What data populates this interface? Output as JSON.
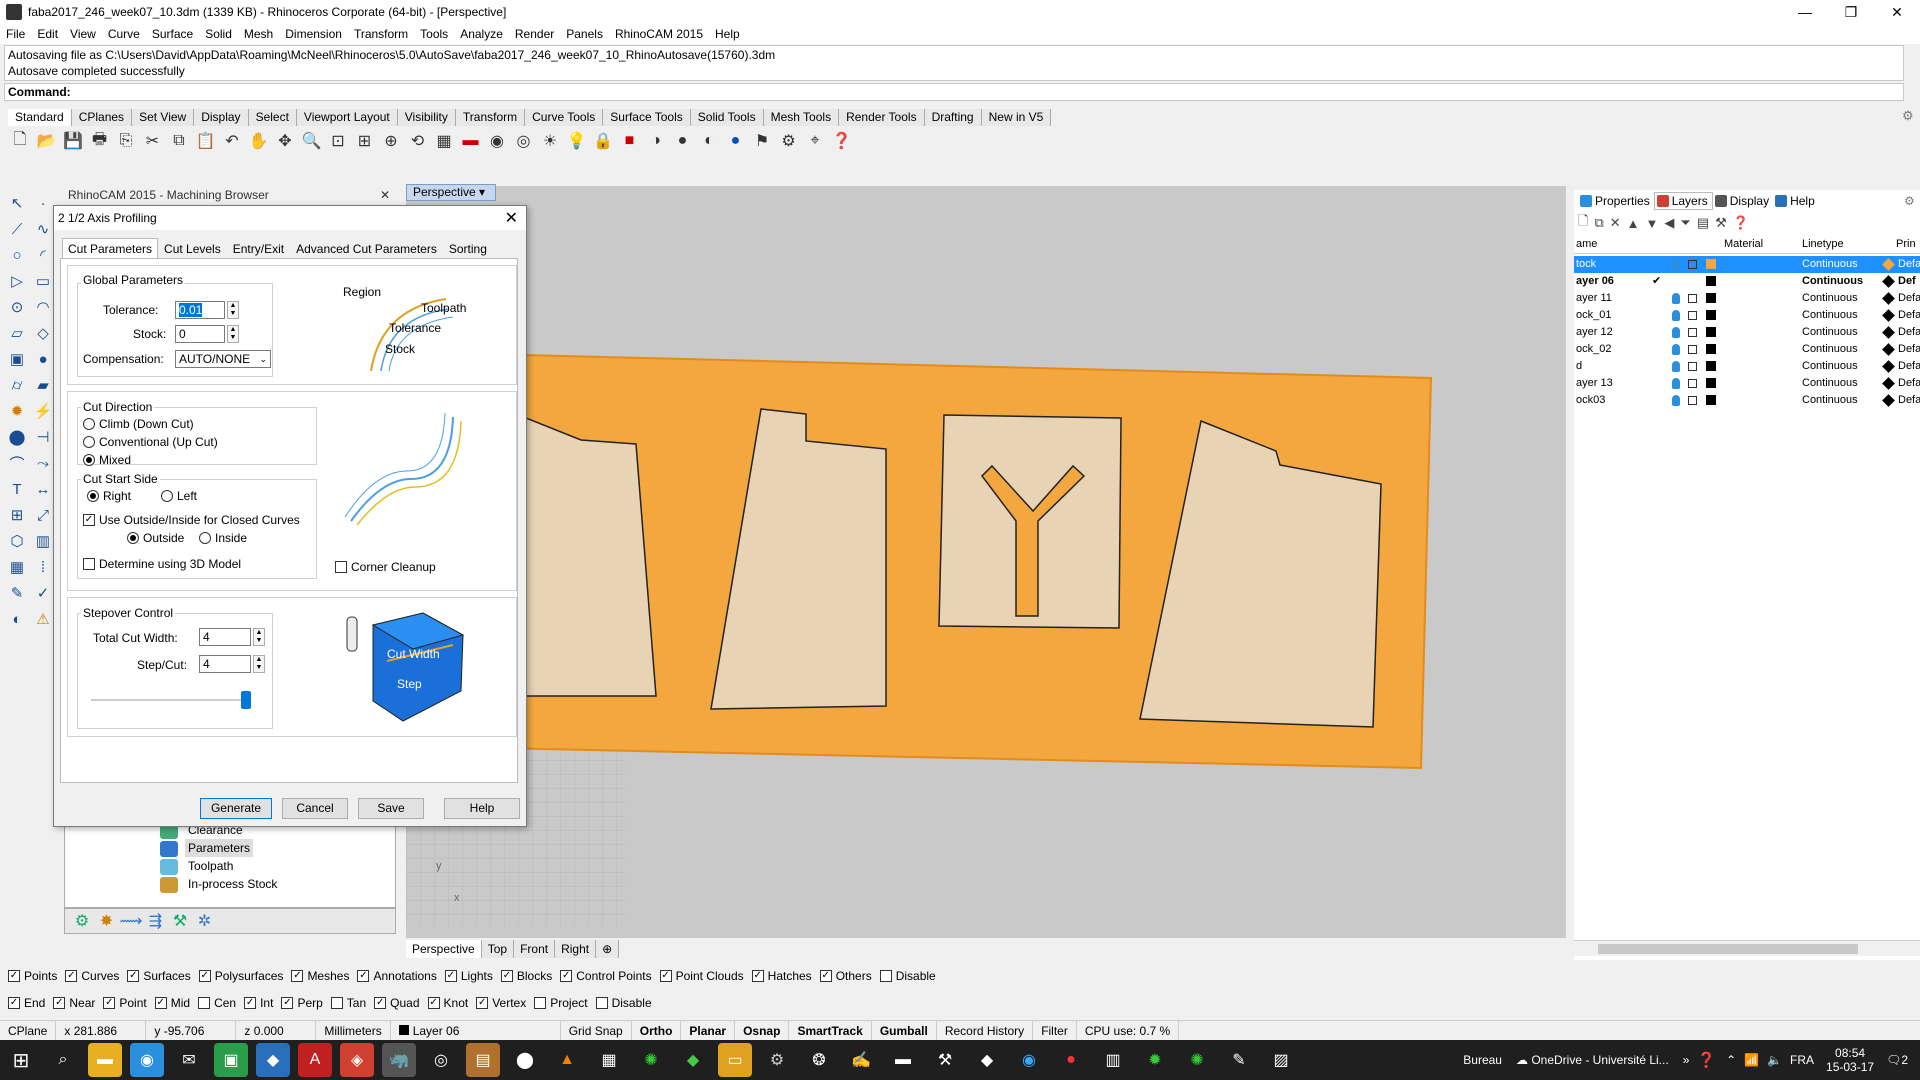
{
  "window": {
    "title": "faba2017_246_week07_10.3dm (1339 KB) - Rhinoceros Corporate (64-bit) - [Perspective]"
  },
  "menu": [
    "File",
    "Edit",
    "View",
    "Curve",
    "Surface",
    "Solid",
    "Mesh",
    "Dimension",
    "Transform",
    "Tools",
    "Analyze",
    "Render",
    "Panels",
    "RhinoCAM 2015",
    "Help"
  ],
  "command_history": [
    "Autosaving file as C:\\Users\\David\\AppData\\Roaming\\McNeel\\Rhinoceros\\5.0\\AutoSave\\faba2017_246_week07_10_RhinoAutosave(15760).3dm",
    "Autosave completed successfully"
  ],
  "command_prompt": "Command:",
  "toolbar_tabs": [
    "Standard",
    "CPlanes",
    "Set View",
    "Display",
    "Select",
    "Viewport Layout",
    "Visibility",
    "Transform",
    "Curve Tools",
    "Surface Tools",
    "Solid Tools",
    "Mesh Tools",
    "Render Tools",
    "Drafting",
    "New in V5"
  ],
  "machining_browser": {
    "title": "RhinoCAM 2015 - Machining Browser",
    "tree": [
      "Clearance",
      "Parameters",
      "Toolpath",
      "In-process Stock"
    ]
  },
  "viewport": {
    "active": "Perspective",
    "tabs": [
      "Perspective",
      "Top",
      "Front",
      "Right"
    ]
  },
  "dialog": {
    "title": "2 1/2 Axis Profiling",
    "tabs": [
      "Cut Parameters",
      "Cut Levels",
      "Entry/Exit",
      "Advanced Cut Parameters",
      "Sorting"
    ],
    "global_params": {
      "label": "Global Parameters",
      "tolerance_label": "Tolerance:",
      "tolerance": "0.01",
      "stock_label": "Stock:",
      "stock": "0",
      "compensation_label": "Compensation:",
      "compensation": "AUTO/NONE"
    },
    "diagram1": {
      "region": "Region",
      "toolpath": "Toolpath",
      "tolerance": "Tolerance",
      "stock": "Stock"
    },
    "cut_direction": {
      "label": "Cut Direction",
      "options": [
        "Climb (Down Cut)",
        "Conventional (Up Cut)",
        "Mixed"
      ]
    },
    "cut_start": {
      "label": "Cut Start Side",
      "right": "Right",
      "left": "Left",
      "use_outside": "Use Outside/Inside for Closed Curves",
      "outside": "Outside",
      "inside": "Inside",
      "determine": "Determine using 3D Model"
    },
    "corner_cleanup": "Corner Cleanup",
    "stepover": {
      "label": "Stepover Control",
      "total_label": "Total Cut Width:",
      "total": "4",
      "step_label": "Step/Cut:",
      "step": "4"
    },
    "diagram3": {
      "cut_width": "Cut Width",
      "step": "Step"
    },
    "buttons": {
      "generate": "Generate",
      "cancel": "Cancel",
      "save": "Save",
      "help": "Help"
    }
  },
  "right_panel": {
    "tabs": [
      "Properties",
      "Layers",
      "Display",
      "Help"
    ],
    "columns": {
      "name": "ame",
      "material": "Material",
      "linetype": "Linetype",
      "print": "Prin"
    },
    "layers": [
      {
        "name": "tock",
        "linetype": "Continuous",
        "print": "Defa"
      },
      {
        "name": "ayer 06",
        "linetype": "Continuous",
        "print": "Def"
      },
      {
        "name": "ayer 11",
        "linetype": "Continuous",
        "print": "Defa"
      },
      {
        "name": "ock_01",
        "linetype": "Continuous",
        "print": "Defa"
      },
      {
        "name": "ayer 12",
        "linetype": "Continuous",
        "print": "Defa"
      },
      {
        "name": "ock_02",
        "linetype": "Continuous",
        "print": "Defa"
      },
      {
        "name": "d",
        "linetype": "Continuous",
        "print": "Defa"
      },
      {
        "name": "ayer 13",
        "linetype": "Continuous",
        "print": "Defa"
      },
      {
        "name": "ock03",
        "linetype": "Continuous",
        "print": "Defa"
      }
    ]
  },
  "filters": [
    "Points",
    "Curves",
    "Surfaces",
    "Polysurfaces",
    "Meshes",
    "Annotations",
    "Lights",
    "Blocks",
    "Control Points",
    "Point Clouds",
    "Hatches",
    "Others",
    "Disable"
  ],
  "snaps": [
    "End",
    "Near",
    "Point",
    "Mid",
    "Cen",
    "Int",
    "Perp",
    "Tan",
    "Quad",
    "Knot",
    "Vertex",
    "Project",
    "Disable"
  ],
  "status": {
    "cplane": "CPlane",
    "x": "x 281.886",
    "y": "y -95.706",
    "z": "z 0.000",
    "units": "Millimeters",
    "layer": "Layer 06",
    "grid": "Grid Snap",
    "ortho": "Ortho",
    "planar": "Planar",
    "osnap": "Osnap",
    "smarttrack": "SmartTrack",
    "gumball": "Gumball",
    "history": "Record History",
    "filter": "Filter",
    "cpu": "CPU use: 0.7 %"
  },
  "taskbar": {
    "bureau": "Bureau",
    "onedrive": "OneDrive - Université Li...",
    "lang": "FRA",
    "time": "08:54",
    "date": "15-03-17",
    "notif": "2"
  }
}
